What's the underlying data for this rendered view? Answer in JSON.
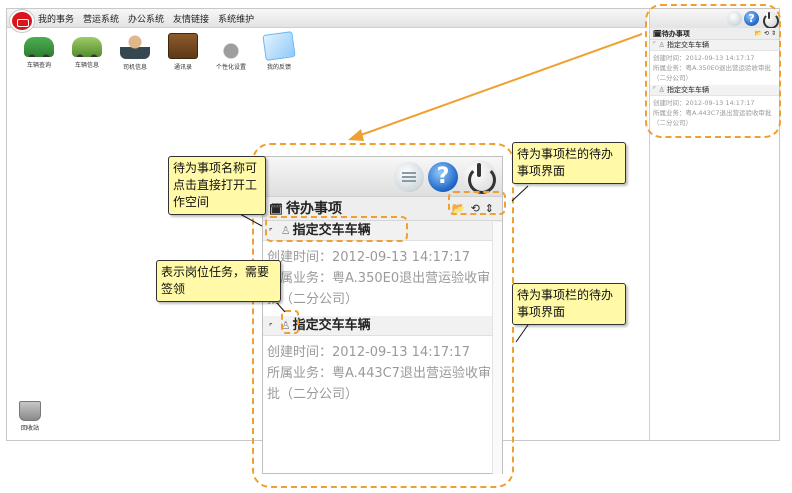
{
  "menubar": {
    "items": [
      "我的事务",
      "营运系统",
      "办公系统",
      "友情链接",
      "系统维护"
    ]
  },
  "desktop": {
    "icons": [
      {
        "label": "车辆查询",
        "icon": "green-car-icon"
      },
      {
        "label": "车辆信息",
        "icon": "car-icon"
      },
      {
        "label": "司机信息",
        "icon": "driver-icon"
      },
      {
        "label": "通讯录",
        "icon": "contacts-icon"
      },
      {
        "label": "个性化设置",
        "icon": "settings-icon"
      },
      {
        "label": "我的反馈",
        "icon": "feedback-icon"
      }
    ],
    "recycle_label": "回收站"
  },
  "toolbar": {
    "help_glyph": "?"
  },
  "todo": {
    "title": "待办事项",
    "calendar_glyph": "🗓",
    "controls": [
      "📂",
      "⟲",
      "⇕"
    ],
    "items": [
      {
        "name": "指定交车车辆",
        "created": "创建时间：2012-09-13 14:17:17",
        "business": "所属业务：粤A.350E0退出营运验收审批（二分公司）"
      },
      {
        "name": "指定交车车辆",
        "created": "创建时间：2012-09-13 14:17:17",
        "business": "所属业务：粤A.443C7退出营运验收审批（二分公司）"
      }
    ]
  },
  "callouts": {
    "name_click": "待为事项名称可点击直接打开工作空间",
    "todo_panel_1": "待为事项栏的待办事项界面",
    "post_task": "表示岗位任务，需要签领",
    "todo_panel_2": "待为事项栏的待办事项界面"
  },
  "colors": {
    "highlight": "#f0a030",
    "callout_bg": "#fff9a8",
    "logo": "#d8161b"
  }
}
